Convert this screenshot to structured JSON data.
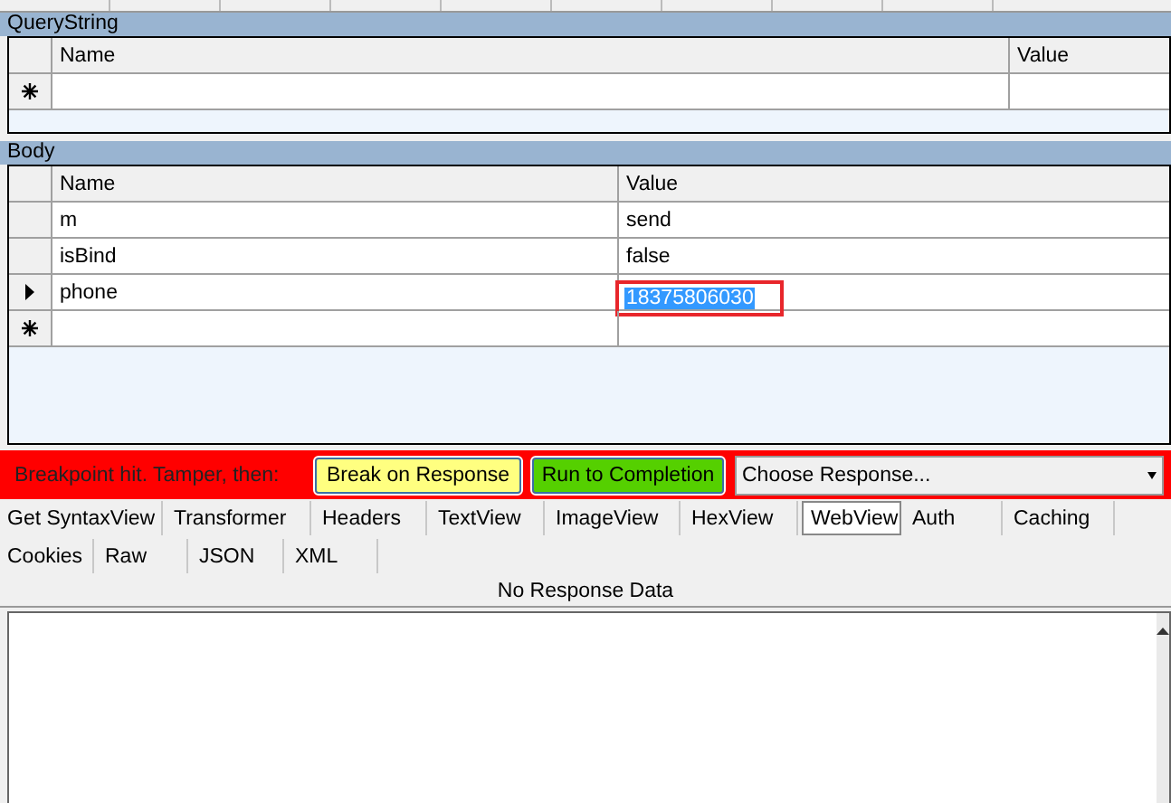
{
  "query_string": {
    "title": "QueryString",
    "columns": [
      "Name",
      "Value"
    ],
    "rows": [
      {
        "kind": "new",
        "name": "",
        "value": ""
      }
    ]
  },
  "body": {
    "title": "Body",
    "columns": [
      "Name",
      "Value"
    ],
    "rows": [
      {
        "kind": "normal",
        "name": "m",
        "value": "send",
        "highlighted": false
      },
      {
        "kind": "normal",
        "name": "isBind",
        "value": "false",
        "highlighted": false
      },
      {
        "kind": "current",
        "name": "phone",
        "value": "18375806030",
        "highlighted": true
      },
      {
        "kind": "new",
        "name": "",
        "value": "",
        "highlighted": false
      }
    ]
  },
  "breakpoint_bar": {
    "message": "Breakpoint hit. Tamper, then:",
    "buttons": [
      {
        "label": "Break on Response",
        "kind": "break"
      },
      {
        "label": "Run to Completion",
        "kind": "run"
      }
    ],
    "response_dropdown": "Choose Response..."
  },
  "tabs_row_1": [
    {
      "label": "Get SyntaxView",
      "selected": false
    },
    {
      "label": "Transformer",
      "selected": false
    },
    {
      "label": "Headers",
      "selected": false
    },
    {
      "label": "TextView",
      "selected": false
    },
    {
      "label": "ImageView",
      "selected": false
    },
    {
      "label": "HexView",
      "selected": false
    },
    {
      "label": "WebView",
      "selected": true
    },
    {
      "label": "Auth",
      "selected": false
    },
    {
      "label": "Caching",
      "selected": false
    }
  ],
  "tabs_row_2": [
    {
      "label": "Cookies",
      "selected": false
    },
    {
      "label": "Raw",
      "selected": false
    },
    {
      "label": "JSON",
      "selected": false
    },
    {
      "label": "XML",
      "selected": false
    }
  ],
  "response_status": "No Response Data"
}
